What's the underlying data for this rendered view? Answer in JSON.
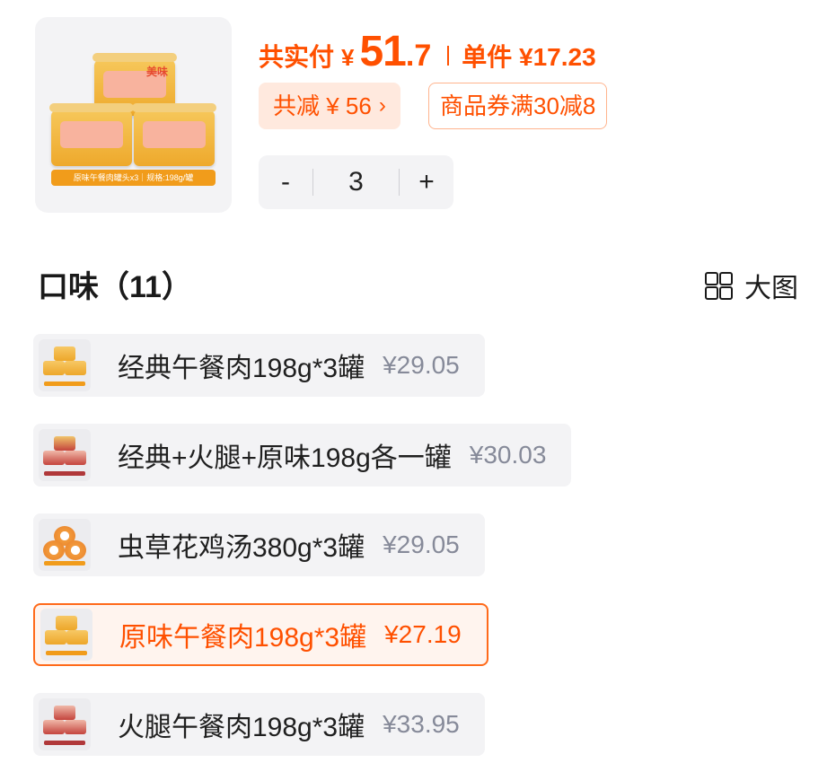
{
  "product": {
    "image_label": "原味午餐肉罐头x3｜规格:198g/罐",
    "brand_mark": "美味"
  },
  "price": {
    "paid_label": "共实付",
    "currency": "¥",
    "paid_integer": "51",
    "paid_decimal": ".7",
    "unit_price": "单件 ¥17.23"
  },
  "discount": {
    "label": "共减 ¥ 56",
    "chevron": "›"
  },
  "coupon": {
    "label": "商品券满30减8"
  },
  "quantity": {
    "minus": "-",
    "value": "3",
    "plus": "+"
  },
  "section": {
    "title": "口味（11）",
    "view_toggle": "大图"
  },
  "options": [
    {
      "name": "经典午餐肉198g*3罐",
      "price": "¥29.05",
      "selected": false
    },
    {
      "name": "经典+火腿+原味198g各一罐",
      "price": "¥30.03",
      "selected": false
    },
    {
      "name": "虫草花鸡汤380g*3罐",
      "price": "¥29.05",
      "selected": false
    },
    {
      "name": "原味午餐肉198g*3罐",
      "price": "¥27.19",
      "selected": true
    },
    {
      "name": "火腿午餐肉198g*3罐",
      "price": "¥33.95",
      "selected": false
    }
  ],
  "colors": {
    "accent": "#ff5000",
    "muted_price": "#868a99",
    "chip_bg": "#f3f3f5"
  },
  "icons": [
    "grid-icon",
    "chevron-right-icon"
  ]
}
